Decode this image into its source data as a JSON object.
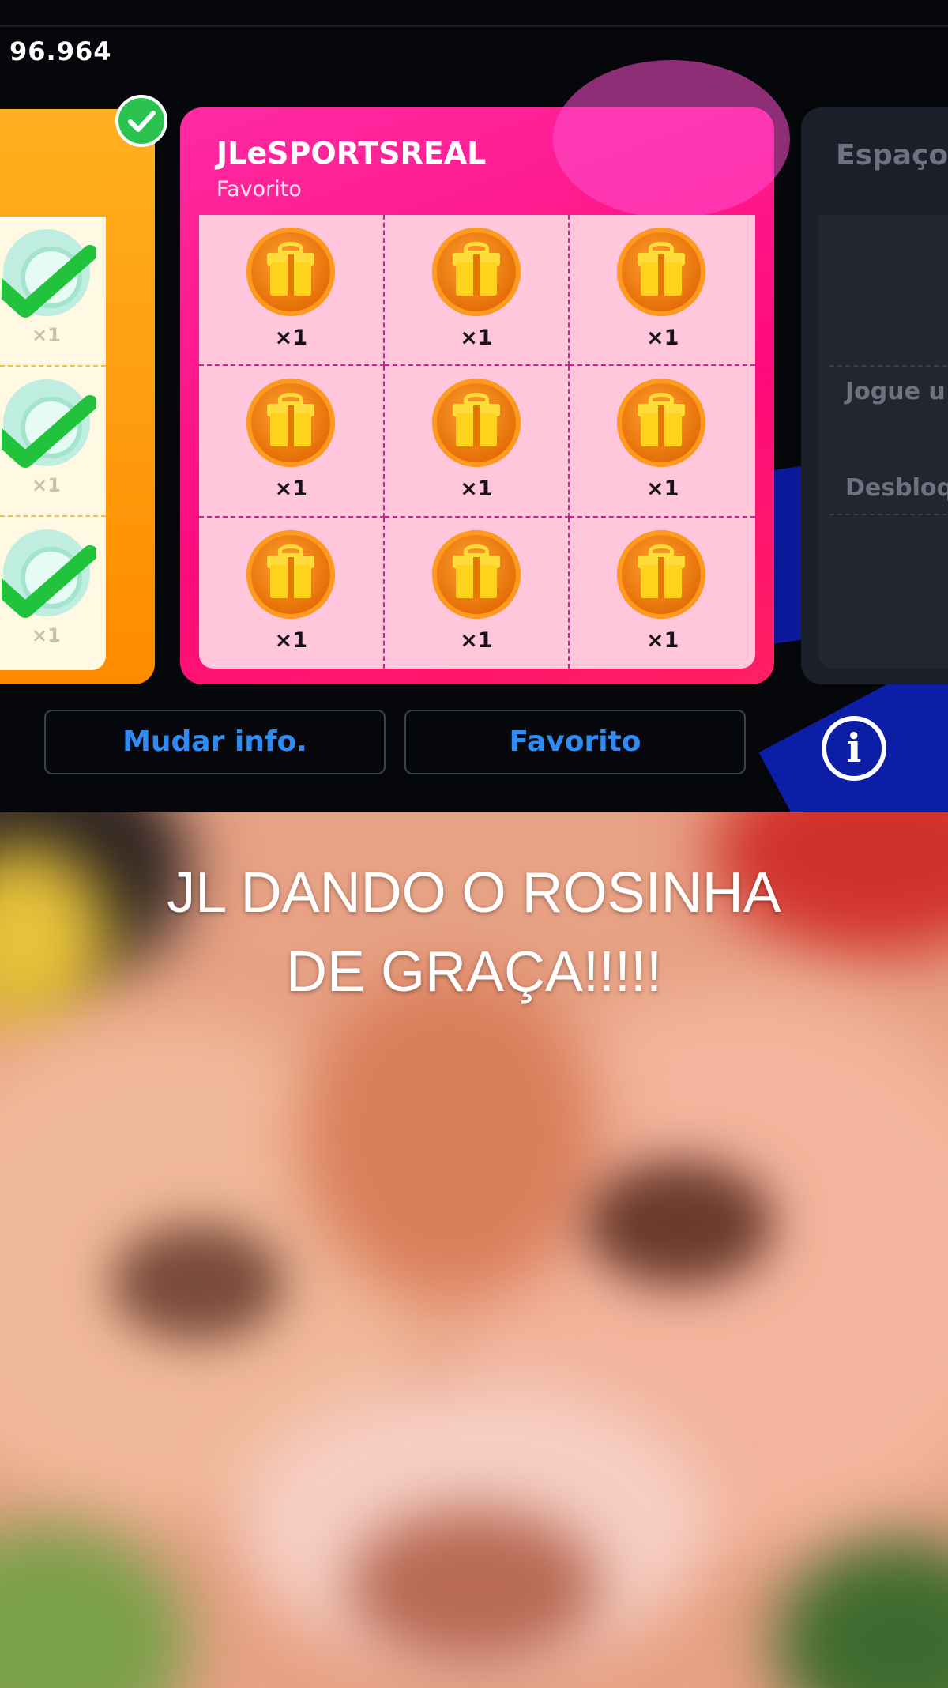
{
  "status": {
    "coins": "96.964"
  },
  "left_card": {
    "rows": [
      {
        "qty": "×1"
      },
      {
        "qty": "×1"
      },
      {
        "qty": "×1"
      }
    ]
  },
  "pink_card": {
    "title": "JLeSPORTSREAL",
    "subtitle": "Favorito",
    "items": [
      "×1",
      "×1",
      "×1",
      "×1",
      "×1",
      "×1",
      "×1",
      "×1",
      "×1"
    ]
  },
  "grey_card": {
    "title": "Espaço",
    "line1": "Jogue u",
    "line2": "Desbloq"
  },
  "buttons": {
    "change_info": "Mudar info.",
    "favorite": "Favorito",
    "info": "i"
  },
  "meme": {
    "caption_line1": "JL DANDO O ROSINHA",
    "caption_line2": "DE GRAÇA!!!!!"
  },
  "colors": {
    "pink_card": "#ff0a7a",
    "orange_card": "#ff9a10",
    "button_text": "#2f8cf5"
  }
}
